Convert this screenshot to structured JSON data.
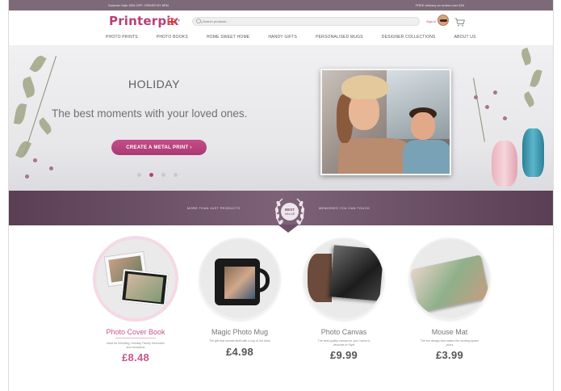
{
  "topbar": {
    "left_text": "Summer Sale 30% OFF: ORDER BY 8PM",
    "right_text": "FREE delivery on orders over £30"
  },
  "header": {
    "logo": "Printerpix",
    "search_placeholder": "Search products...",
    "signin_label": "Sign in"
  },
  "nav": {
    "items": [
      "PHOTO PRINTS",
      "PHOTO BOOKS",
      "HOME SWEET HOME",
      "HANDY GIFTS",
      "PERSONALISED MUGS",
      "DESIGNER COLLECTIONS",
      "ABOUT US"
    ]
  },
  "hero": {
    "title": "HOLIDAY",
    "subtitle": "The best moments with your loved ones.",
    "cta_label": "CREATE A METAL PRINT ›",
    "slides": 4,
    "active_slide": 2
  },
  "banner": {
    "left_text": "MORE THAN JUST PRODUCTS",
    "right_text": "MEMORIES YOU CAN TOUCH",
    "badge_line1": "BEST",
    "badge_line2": "VALUE"
  },
  "products": [
    {
      "name": "Photo Cover Book",
      "description": "Ideal for Wedding, Holiday, Family memories and occasions",
      "price": "£8.48",
      "highlighted": true
    },
    {
      "name": "Magic Photo Mug",
      "description": "The gift that reveals itself with a cup of hot drink",
      "price": "£4.98",
      "highlighted": false
    },
    {
      "name": "Photo Canvas",
      "description": "The best quality canvas for your home to decorate in Style",
      "price": "£9.99",
      "highlighted": false
    },
    {
      "name": "Mouse Mat",
      "description": "The fun design that makes the working space yours",
      "price": "£3.99",
      "highlighted": false
    }
  ],
  "colors": {
    "brand": "#b73f7a",
    "banner": "#6b5066",
    "topbar": "#7d6a78"
  }
}
